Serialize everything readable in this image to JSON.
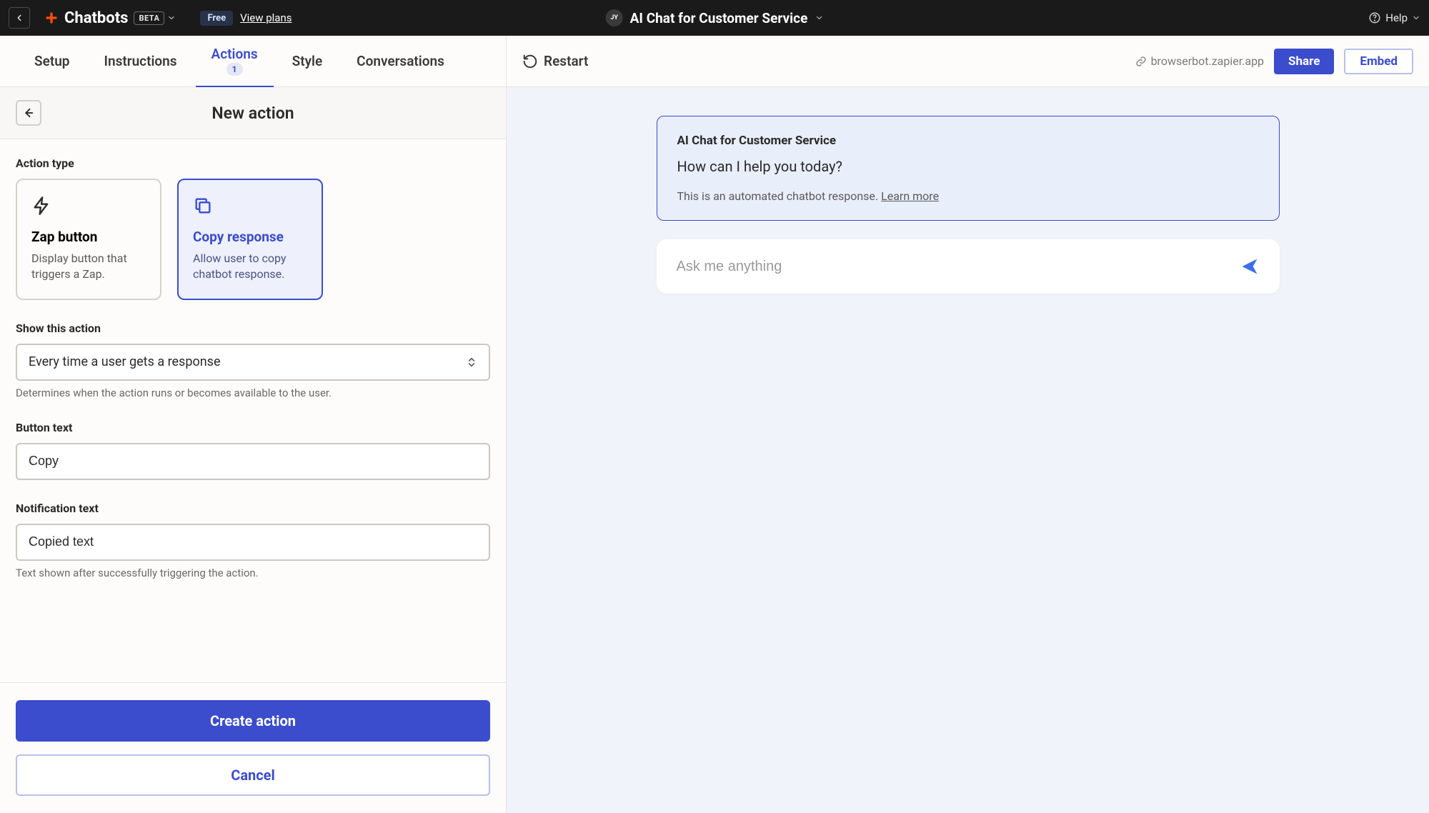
{
  "topbar": {
    "brand": "Chatbots",
    "beta": "BETA",
    "plan": "Free",
    "view_plans": "View plans",
    "avatar_initials": "JY",
    "project_name": "AI Chat for Customer Service",
    "help": "Help"
  },
  "tabs": {
    "setup": "Setup",
    "instructions": "Instructions",
    "actions": "Actions",
    "actions_count": "1",
    "style": "Style",
    "conversations": "Conversations"
  },
  "preview_controls": {
    "restart": "Restart",
    "url": "browserbot.zapier.app",
    "share": "Share",
    "embed": "Embed"
  },
  "panel": {
    "title": "New action",
    "action_type_label": "Action type",
    "zap_card_title": "Zap button",
    "zap_card_desc": "Display button that triggers a Zap.",
    "copy_card_title": "Copy response",
    "copy_card_desc": "Allow user to copy chatbot response.",
    "show_label": "Show this action",
    "show_value": "Every time a user gets a response",
    "show_helper": "Determines when the action runs or becomes available to the user.",
    "button_text_label": "Button text",
    "button_text_value": "Copy",
    "notification_label": "Notification text",
    "notification_value": "Copied text",
    "notification_helper": "Text shown after successfully triggering the action.",
    "create": "Create action",
    "cancel": "Cancel"
  },
  "chat": {
    "bot_name": "AI Chat for Customer Service",
    "greeting": "How can I help you today?",
    "disclaimer": "This is an automated chatbot response. ",
    "learn_more": "Learn more",
    "placeholder": "Ask me anything"
  }
}
